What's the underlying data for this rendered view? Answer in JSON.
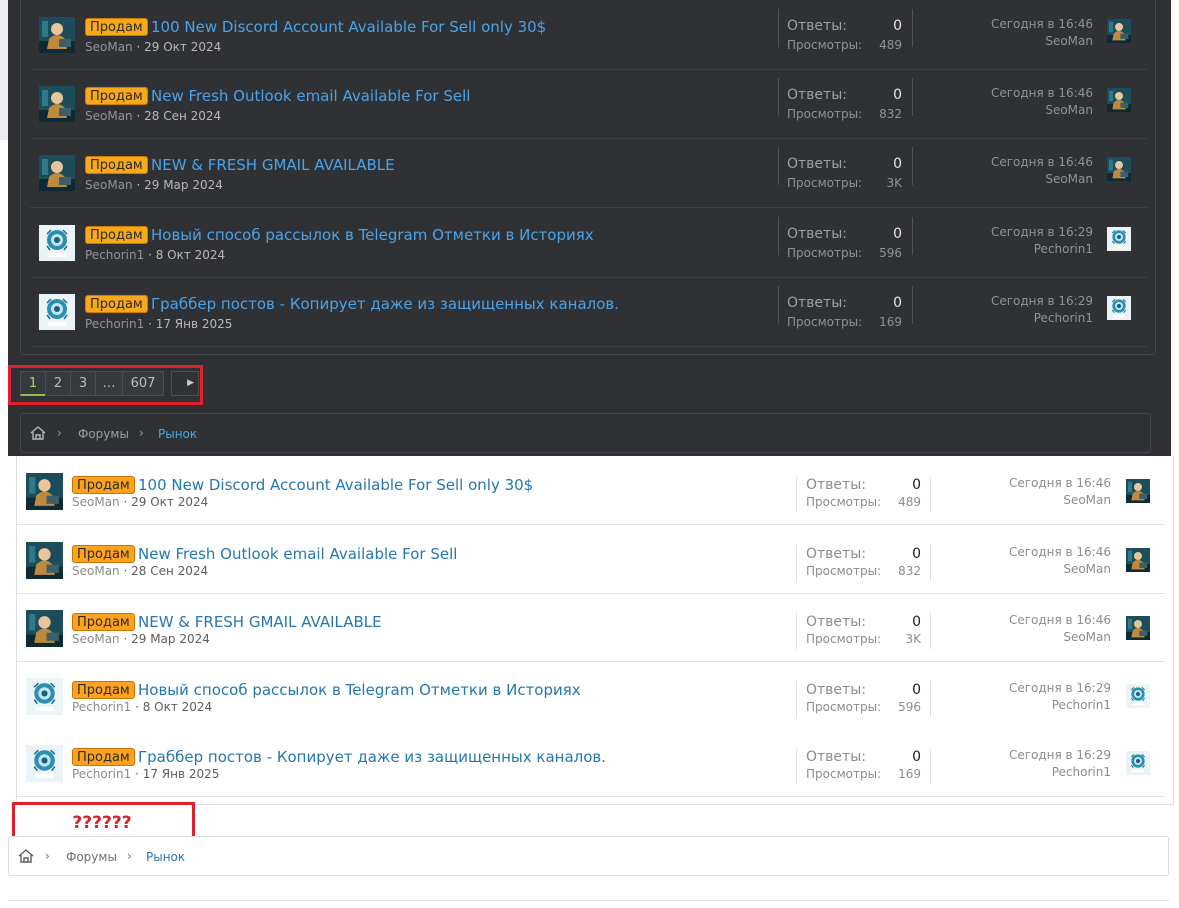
{
  "colors": {
    "dark_bg": "#2f3134",
    "dark_link": "#4aa3e8",
    "light_link": "#2577b1",
    "prefix_bg": "#f7a81b",
    "highlight_red": "#e0202a",
    "pager_active": "#8bc34a"
  },
  "threads": [
    {
      "prefix": "Продам",
      "title": "100 New Discord Account Available For Sell only 30$",
      "author": "SeoMan",
      "date": "29 Окт 2024",
      "replies_label": "Ответы:",
      "replies": "0",
      "views_label": "Просмотры:",
      "views": "489",
      "last_time": "Сегодня в 16:46",
      "last_user": "SeoMan",
      "avatar": "seoman-avatar"
    },
    {
      "prefix": "Продам",
      "title": "New Fresh Outlook email Available For Sell",
      "author": "SeoMan",
      "date": "28 Сен 2024",
      "replies_label": "Ответы:",
      "replies": "0",
      "views_label": "Просмотры:",
      "views": "832",
      "last_time": "Сегодня в 16:46",
      "last_user": "SeoMan",
      "avatar": "seoman-avatar"
    },
    {
      "prefix": "Продам",
      "title": "NEW & FRESH GMAIL AVAILABLE",
      "author": "SeoMan",
      "date": "29 Мар 2024",
      "replies_label": "Ответы:",
      "replies": "0",
      "views_label": "Просмотры:",
      "views": "3K",
      "last_time": "Сегодня в 16:46",
      "last_user": "SeoMan",
      "avatar": "seoman-avatar"
    },
    {
      "prefix": "Продам",
      "title": "Новый способ рассылок в Telegram Отметки в Историях",
      "author": "Pechorin1",
      "date": "8 Окт 2024",
      "replies_label": "Ответы:",
      "replies": "0",
      "views_label": "Просмотры:",
      "views": "596",
      "last_time": "Сегодня в 16:29",
      "last_user": "Pechorin1",
      "avatar": "pechorin-avatar"
    },
    {
      "prefix": "Продам",
      "title": "Граббер постов - Копирует даже из защищенных каналов.",
      "author": "Pechorin1",
      "date": "17 Янв 2025",
      "replies_label": "Ответы:",
      "replies": "0",
      "views_label": "Просмотры:",
      "views": "169",
      "last_time": "Сегодня в 16:29",
      "last_user": "Pechorin1",
      "avatar": "pechorin-avatar"
    }
  ],
  "pagination": {
    "pages": [
      "1",
      "2",
      "3",
      "…",
      "607"
    ],
    "current": "1",
    "next_icon": "caret-right-icon"
  },
  "breadcrumb": {
    "home_icon": "home-icon",
    "items": [
      "Форумы",
      "Рынок"
    ]
  },
  "annotation": {
    "missing_label": "??????"
  }
}
